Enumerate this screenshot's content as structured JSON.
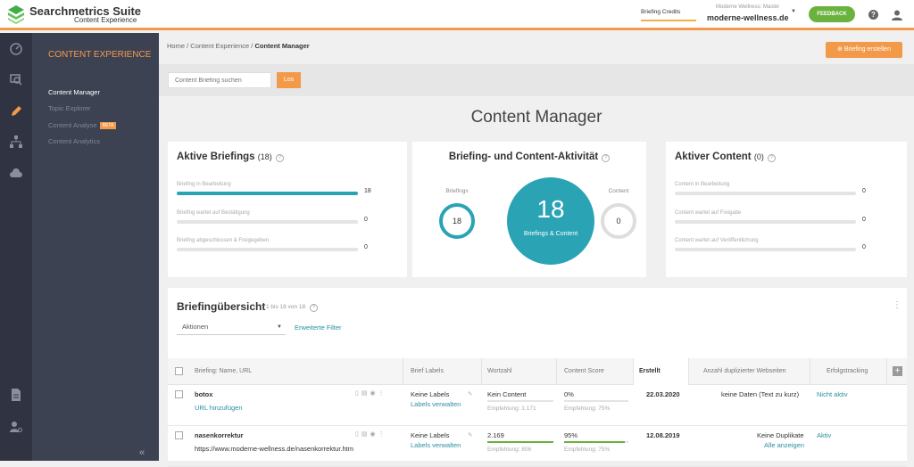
{
  "app": {
    "name": "Searchmetrics Suite",
    "subtitle": "Content Experience"
  },
  "topbar": {
    "briefing_credits": "Briefing Credits",
    "account_sub": "Moderne Wellness: Master",
    "account": "moderne-wellness.de",
    "feedback": "FEEDBACK"
  },
  "subnav": {
    "title": "CONTENT EXPERIENCE",
    "items": [
      "Content Manager",
      "Topic Explorer",
      "Content Analyse",
      "Content Analytics"
    ],
    "beta": "BETA"
  },
  "breadcrumb": {
    "home": "Home",
    "section": "Content Experience",
    "current": "Content Manager",
    "sep": "/"
  },
  "create_button": "Briefing erstellen",
  "search": {
    "placeholder": "Content Briefing suchen",
    "button": "Los"
  },
  "page_title": "Content Manager",
  "aktive_briefings": {
    "title": "Aktive Briefings",
    "count": "(18)",
    "rows": [
      {
        "label": "Briefing in Bearbeitung",
        "value": "18",
        "fraction": 1.0
      },
      {
        "label": "Briefing wartet auf Bestätigung",
        "value": "0",
        "fraction": 0
      },
      {
        "label": "Briefing abgeschlossen & Freigegeben",
        "value": "0",
        "fraction": 0
      }
    ]
  },
  "aktivitaet": {
    "title": "Briefing- und Content-Aktivität",
    "briefings_label": "Briefings",
    "briefings_value": "18",
    "content_label": "Content",
    "content_value": "0",
    "total_value": "18",
    "total_label": "Briefings & Content"
  },
  "aktiver_content": {
    "title": "Aktiver Content",
    "count": "(0)",
    "rows": [
      {
        "label": "Content in Bearbeitung",
        "value": "0",
        "fraction": 0
      },
      {
        "label": "Content wartet auf Freigabe",
        "value": "0",
        "fraction": 0
      },
      {
        "label": "Content wartet auf Veröffentlichung",
        "value": "0",
        "fraction": 0
      }
    ]
  },
  "overview": {
    "title": "Briefingübersicht",
    "count": "1 bis 18 von 18",
    "actions": "Aktionen",
    "filter": "Erweiterte Filter",
    "columns": [
      "Briefing: Name, URL",
      "Brief Labels",
      "Wortzahl",
      "Content Score",
      "Erstellt",
      "Anzahl duplizierter Webseiten",
      "Erfolgstracking"
    ],
    "rows": [
      {
        "name": "botox",
        "url": "URL hinzufügen",
        "labels": "Keine Labels",
        "labels_link": "Labels verwalten",
        "wortzahl": "Kein Content",
        "wortzahl_rec": "Empfehlung: 1.171",
        "wortzahl_fraction": 0,
        "score": "0%",
        "score_rec": "Empfehlung: 75%",
        "score_fraction": 0,
        "erstellt": "22.03.2020",
        "duplikate": "keine Daten (Text zu kurz)",
        "duplikate_link": "",
        "tracking": "Nicht aktiv"
      },
      {
        "name": "nasenkorrektur",
        "url": "https://www.moderne-wellness.de/nasenkorrektur.htm",
        "labels": "Keine Labels",
        "labels_link": "Labels verwalten",
        "wortzahl": "2.169",
        "wortzahl_rec": "Empfehlung: 806",
        "wortzahl_fraction": 1.0,
        "score": "95%",
        "score_rec": "Empfehlung: 75%",
        "score_fraction": 0.95,
        "erstellt": "12.08.2019",
        "duplikate": "Keine Duplikate",
        "duplikate_link": "Alle anzeigen",
        "tracking": "Aktiv"
      }
    ]
  },
  "colors": {
    "accent": "#f39a4a",
    "teal": "#2aa3b5",
    "green": "#6ab23e",
    "sidebar": "#2f3342",
    "subnav": "#3d4253"
  }
}
